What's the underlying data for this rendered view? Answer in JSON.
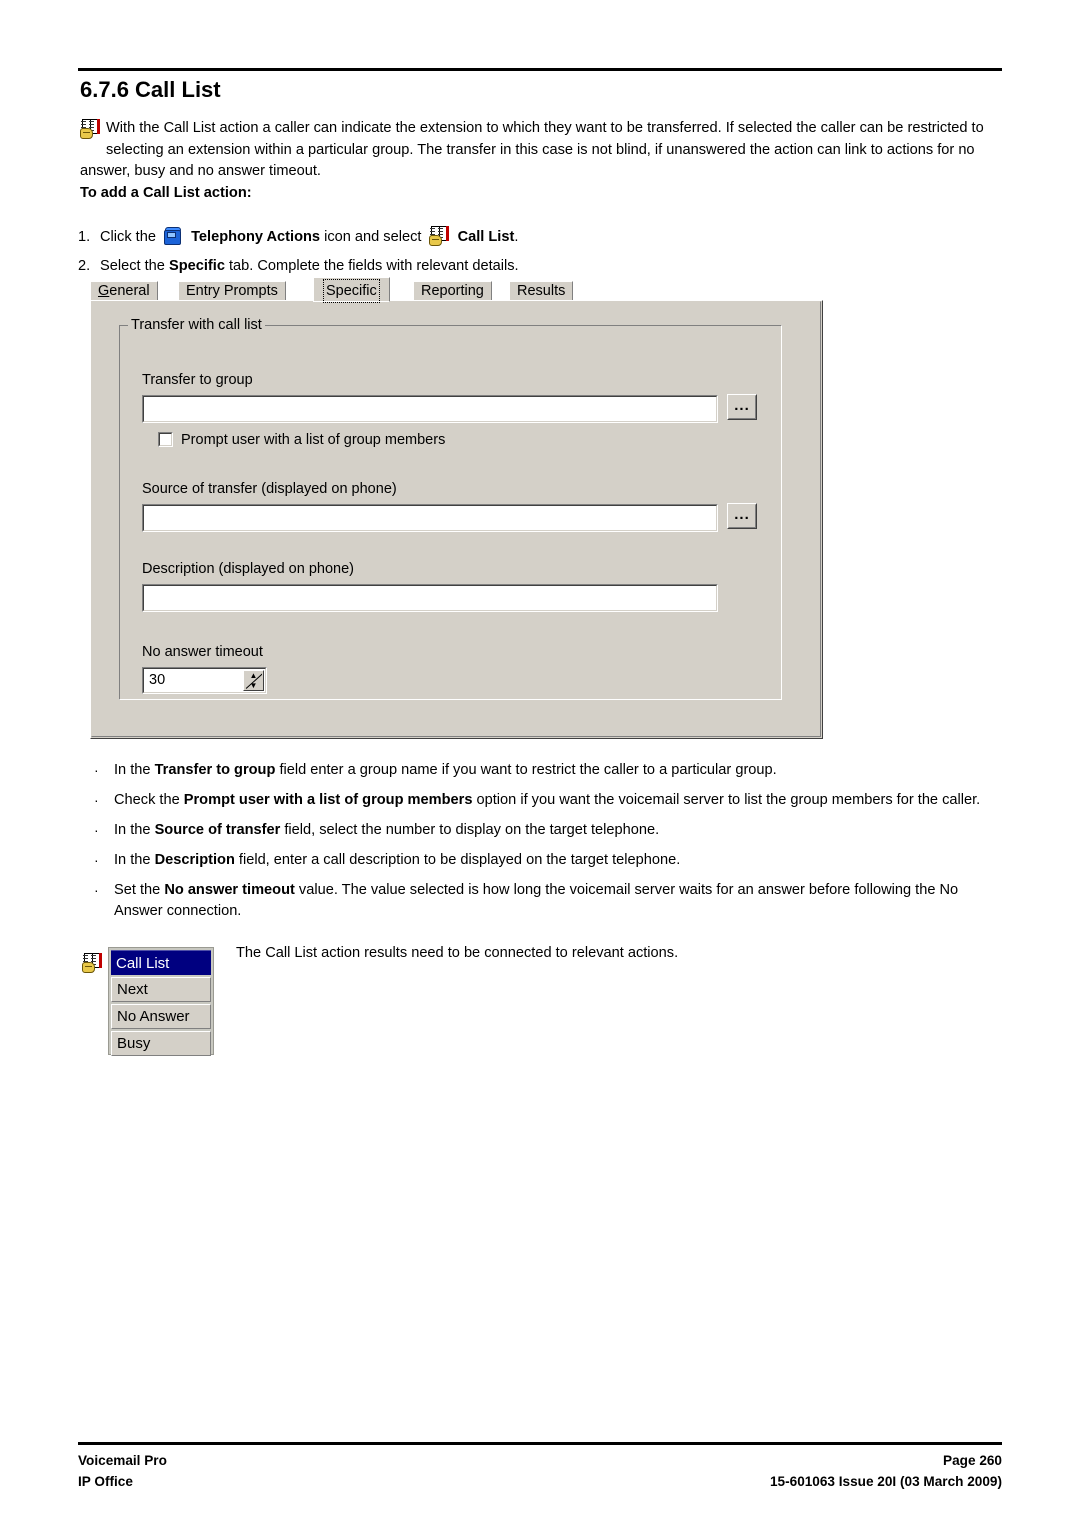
{
  "document": {
    "section_number": "6.7.6",
    "section_title": "6.7.6 Call List",
    "intro_paragraph": "With the Call List action a caller can indicate the extension to which they want to be transferred. If selected the caller can be restricted to selecting an extension within a particular group. The transfer in this case is not blind, if unanswered the action can link to actions for no answer, busy and no answer timeout.",
    "procedure_heading": "To add a Call List action:"
  },
  "steps": {
    "step1": {
      "number": "1.",
      "text_before_icon": "Click the",
      "bold_label": "Telephony Actions",
      "text_middle": "icon and select",
      "bold_label2": "Call List",
      "text_end": "."
    },
    "step2": {
      "number": "2.",
      "text_before": "Select the",
      "bold_label": "Specific",
      "text_after": "tab. Complete the fields with relevant details."
    }
  },
  "dialog": {
    "tabs": [
      {
        "label": "General",
        "accelerator": "G",
        "active": false
      },
      {
        "label": "Entry Prompts",
        "active": false
      },
      {
        "label": "Specific",
        "active": true
      },
      {
        "label": "Reporting",
        "active": false
      },
      {
        "label": "Results",
        "active": false
      }
    ],
    "groupbox_title": "Transfer with call list",
    "fields": {
      "transfer_to_group": {
        "label": "Transfer to group",
        "value": "",
        "browse_label": "..."
      },
      "prompt_checkbox": {
        "label": "Prompt user with a list of group members",
        "checked": false
      },
      "source_of_transfer": {
        "label": "Source of transfer (displayed on phone)",
        "value": "",
        "browse_label": "..."
      },
      "description": {
        "label": "Description (displayed on phone)",
        "value": ""
      },
      "no_answer_timeout": {
        "label": "No answer timeout",
        "value": "30"
      }
    }
  },
  "bullets": [
    {
      "marker": "·",
      "parts": [
        {
          "text": "In the ",
          "bold": false
        },
        {
          "text": "Transfer to group",
          "bold": true
        },
        {
          "text": " field enter a group name if you want to restrict the caller to a particular group.",
          "bold": false
        }
      ]
    },
    {
      "marker": "·",
      "parts": [
        {
          "text": "Check the ",
          "bold": false
        },
        {
          "text": "Prompt user with a list of group members",
          "bold": true
        },
        {
          "text": " option if you want the voicemail server to list the group members for the caller.",
          "bold": false
        }
      ]
    },
    {
      "marker": "·",
      "parts": [
        {
          "text": "In the ",
          "bold": false
        },
        {
          "text": "Source of transfer",
          "bold": true
        },
        {
          "text": " field, select the number to display on the target telephone.",
          "bold": false
        }
      ]
    },
    {
      "marker": "·",
      "parts": [
        {
          "text": "In the ",
          "bold": false
        },
        {
          "text": "Description",
          "bold": true
        },
        {
          "text": " field, enter a call description to be displayed on the target telephone.",
          "bold": false
        }
      ]
    },
    {
      "marker": "·",
      "parts": [
        {
          "text": "Set the ",
          "bold": false
        },
        {
          "text": "No answer timeout",
          "bold": true
        },
        {
          "text": " value. The value selected is how long the voicemail server waits for an answer before following the No Answer connection.",
          "bold": false
        }
      ]
    }
  ],
  "action_widget": {
    "title": "Call List",
    "results": [
      "Next",
      "No Answer",
      "Busy"
    ],
    "caption": "The Call List action results need to be connected to relevant actions."
  },
  "footer": {
    "left_line1": "Voicemail Pro",
    "left_line2": "IP Office",
    "right_line1": "Page 260",
    "right_line2": "15-601063 Issue 20I (03 March 2009)"
  },
  "colors": {
    "dialog_face": "#d4d0c8",
    "title_bar": "#000080",
    "text": "#000000"
  }
}
